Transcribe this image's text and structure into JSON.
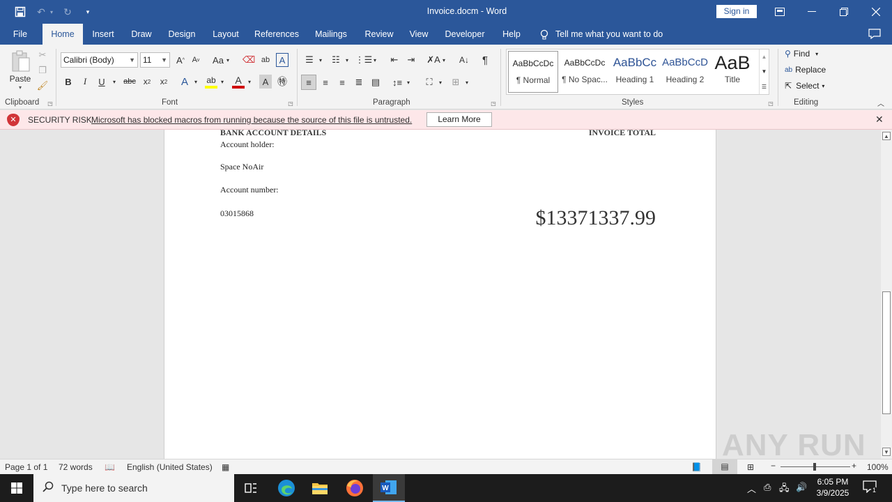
{
  "app": {
    "title": "Invoice.docm",
    "separator": "-",
    "app_name": "Word",
    "sign_in": "Sign in"
  },
  "tabs": [
    "File",
    "Home",
    "Insert",
    "Draw",
    "Design",
    "Layout",
    "References",
    "Mailings",
    "Review",
    "View",
    "Developer",
    "Help"
  ],
  "active_tab": "Home",
  "tell_me": "Tell me what you want to do",
  "ribbon": {
    "clipboard": {
      "label": "Clipboard",
      "paste": "Paste"
    },
    "font": {
      "label": "Font",
      "font_name": "Calibri (Body)",
      "font_size": "11",
      "change_case": "Aa"
    },
    "paragraph": {
      "label": "Paragraph"
    },
    "styles": {
      "label": "Styles",
      "items": [
        {
          "preview": "AaBbCcDc",
          "name": "¶ Normal"
        },
        {
          "preview": "AaBbCcDc",
          "name": "¶ No Spac..."
        },
        {
          "preview": "AaBbCc",
          "name": "Heading 1"
        },
        {
          "preview": "AaBbCcD",
          "name": "Heading 2"
        },
        {
          "preview": "AaB",
          "name": "Title"
        }
      ]
    },
    "editing": {
      "label": "Editing",
      "find": "Find",
      "replace": "Replace",
      "select": "Select"
    }
  },
  "security_bar": {
    "title": "SECURITY RISK",
    "message": "Microsoft has blocked macros from running because the source of this file is untrusted.",
    "button": "Learn More"
  },
  "document": {
    "bank_heading": "BANK ACCOUNT DETAILS",
    "total_heading": "INVOICE TOTAL",
    "holder_label": "Account holder:",
    "holder_value": "Space NoAir",
    "number_label": "Account number:",
    "number_value": "03015868",
    "total_amount": "$13371337.99"
  },
  "status": {
    "page": "Page 1 of 1",
    "words": "72 words",
    "language": "English (United States)",
    "zoom": "100%"
  },
  "taskbar": {
    "search_placeholder": "Type here to search",
    "time": "6:05 PM",
    "date": "3/9/2025",
    "notification_count": "1"
  },
  "watermark": "ANY RUN",
  "colors": {
    "word_blue": "#2b579a",
    "security_bg": "#fde7e9",
    "security_icon": "#d13438"
  }
}
